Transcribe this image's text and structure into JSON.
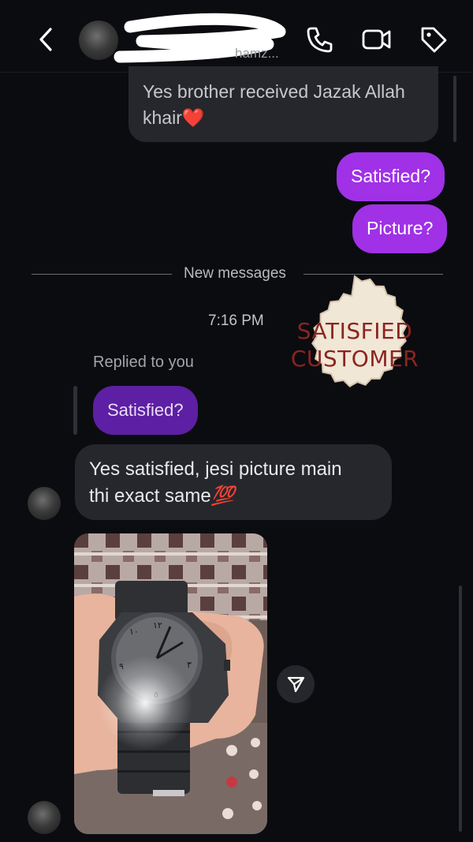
{
  "header": {
    "contact_handle": "hamz...",
    "icons": [
      "chevron-left-icon",
      "phone-icon",
      "video-camera-icon",
      "tag-icon"
    ]
  },
  "messages": {
    "received_msg": "Yes brother received Jazak Allah khair",
    "received_emoji": "❤️",
    "sent_1": "Satisfied?",
    "sent_2": "Picture?",
    "new_messages_label": "New messages",
    "time": "7:16 PM",
    "replied_label": "Replied to you",
    "quoted": "Satisfied?",
    "reply_text_1": "Yes satisfied, jesi picture main",
    "reply_text_2": "thi exact same",
    "reply_emoji": "💯"
  },
  "stamp": {
    "line1": "SATISFIED",
    "line2": "CUSTOMER"
  },
  "colors": {
    "background": "#0b0c10",
    "incoming_bubble": "#26272c",
    "outgoing_bubble": "#a031e6",
    "quoted_bubble": "#5d1fa3",
    "stamp_text": "#8b2420",
    "stamp_paper": "#f1e7d6"
  }
}
